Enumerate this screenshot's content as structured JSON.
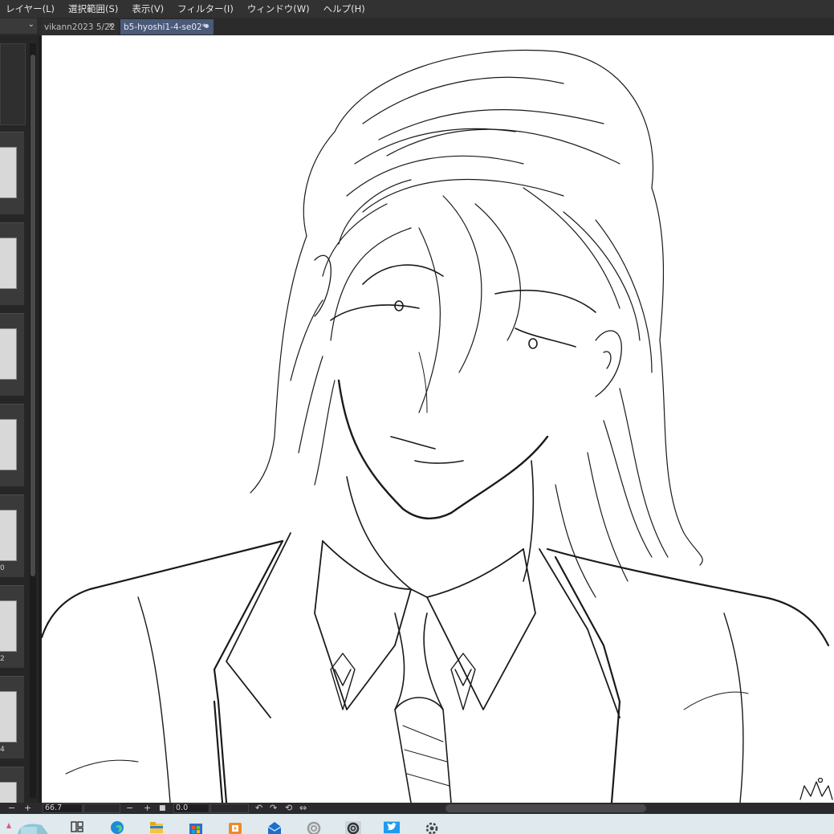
{
  "menu": {
    "items": [
      "レイヤー(L)",
      "選択範囲(S)",
      "表示(V)",
      "フィルター(I)",
      "ウィンドウ(W)",
      "ヘルプ(H)"
    ]
  },
  "tabs": [
    {
      "label": "vikann2023 5/22",
      "active": false
    },
    {
      "label": "b5-hyoshi1-4-se02*",
      "active": true
    }
  ],
  "page_thumbnails": [
    {
      "number": ""
    },
    {
      "number": ""
    },
    {
      "number": ""
    },
    {
      "number": ""
    },
    {
      "number": "0"
    },
    {
      "number": "2"
    },
    {
      "number": "4"
    }
  ],
  "status": {
    "zoom": "66.7",
    "angle": "0.0"
  },
  "taskbar": {
    "icons": [
      "widgets-icon",
      "task-view-icon",
      "edge-icon",
      "file-explorer-icon",
      "store-icon",
      "media-player-icon",
      "mail-icon",
      "clip-studio-icon",
      "clip-studio-paint-icon",
      "twitter-icon",
      "settings-icon"
    ]
  },
  "colors": {
    "menubar_bg": "#323232",
    "active_tab": "#4a5a78",
    "canvas": "#ffffff",
    "taskbar_bg": "#dfe9ee"
  }
}
